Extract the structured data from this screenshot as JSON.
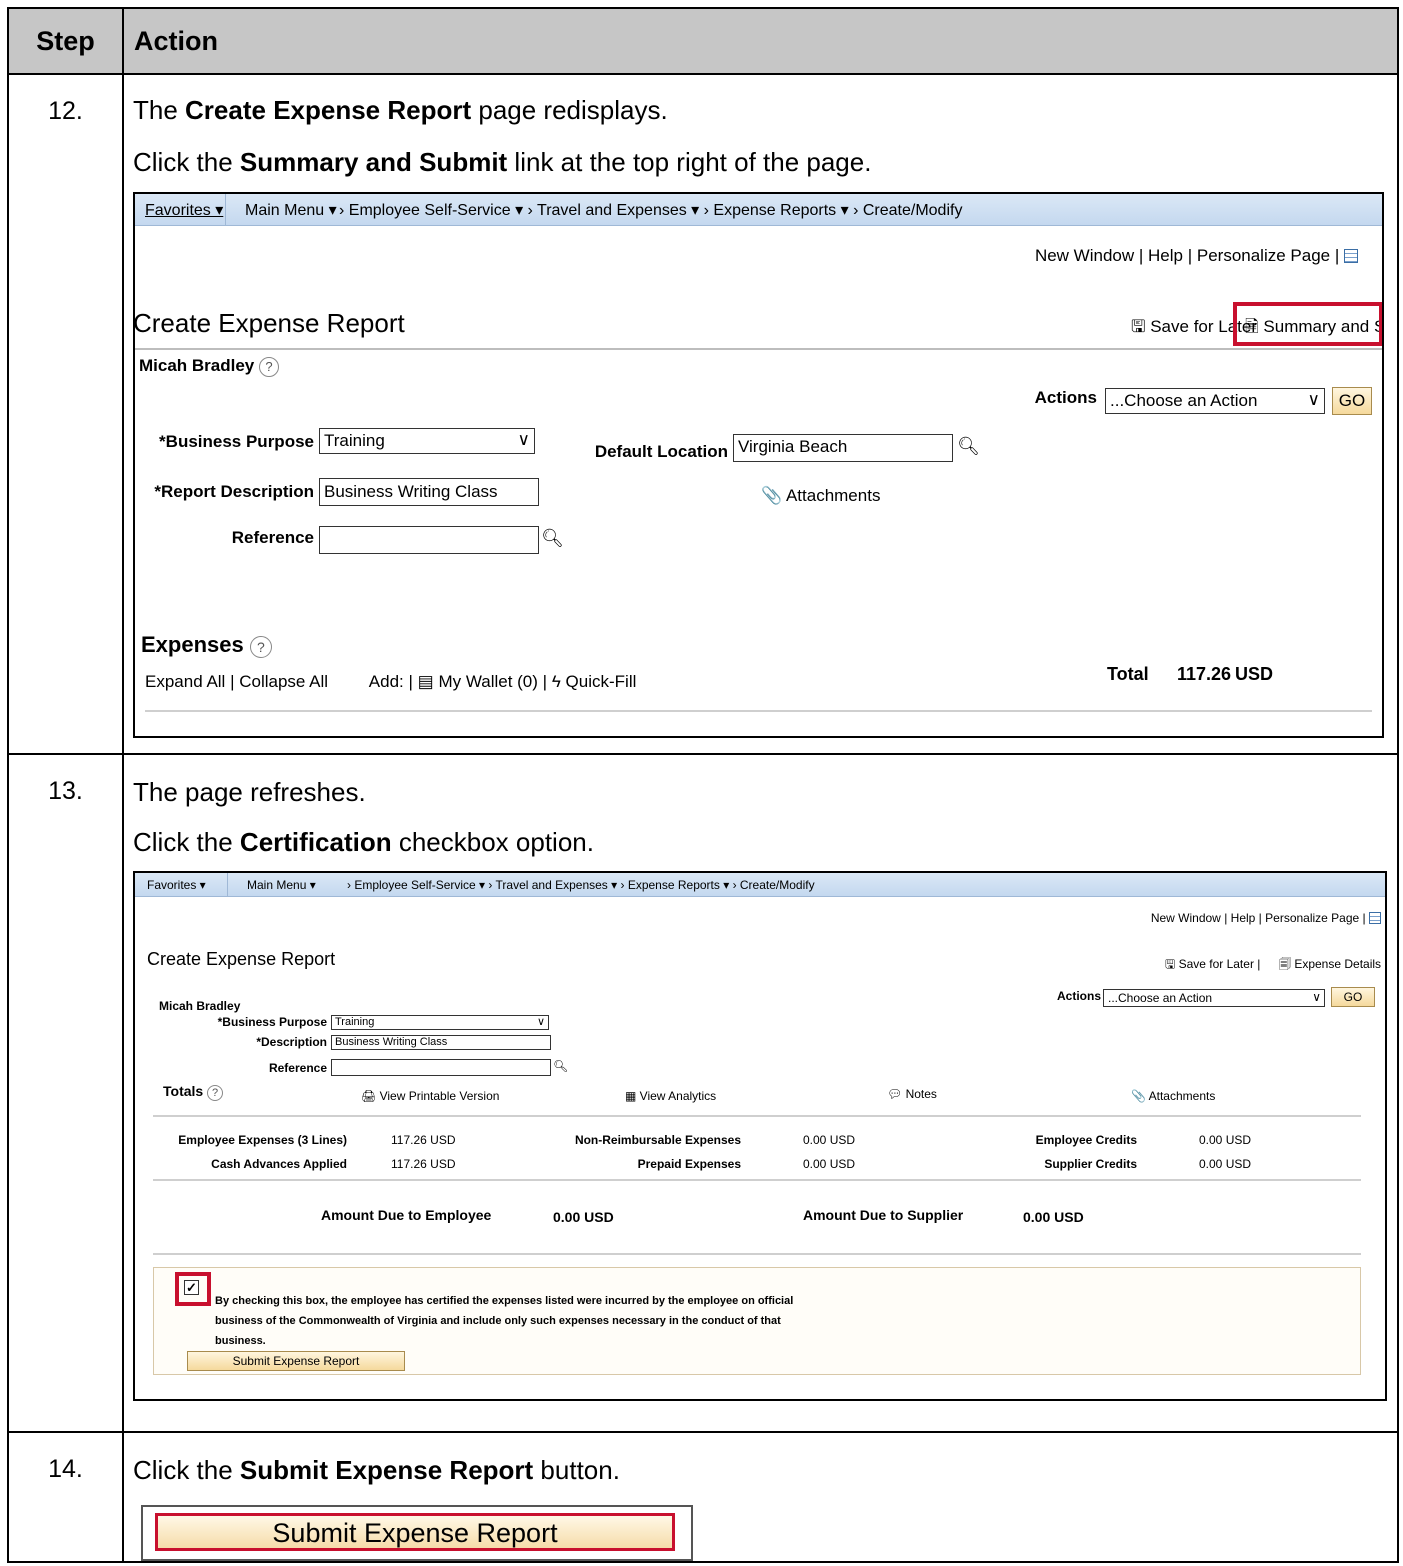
{
  "table": {
    "step_header": "Step",
    "action_header": "Action"
  },
  "step12": {
    "number": "12.",
    "line1_pre": "The ",
    "line1_bold": "Create Expense Report",
    "line1_post": " page redisplays.",
    "line2_pre": "Click the ",
    "line2_bold": "Summary and Submit",
    "line2_post": " link at the top right of the page.",
    "shot": {
      "nav": {
        "favorites": "Favorites ▾",
        "main_menu": "Main Menu ▾",
        "breadcrumb": "› Employee Self-Service ▾  ›  Travel and Expenses ▾  ›  Expense Reports ▾  ›  Create/Modify"
      },
      "top_links": {
        "new_window": "New Window",
        "help": "Help",
        "personalize": "Personalize Page"
      },
      "page_title": "Create Expense Report",
      "save_later": "Save for Later",
      "summary_submit": "Summary and Submit",
      "employee": "Micah Bradley",
      "actions_label": "Actions",
      "actions_value": "...Choose an Action",
      "go": "GO",
      "business_purpose_label": "*Business Purpose",
      "business_purpose_value": "Training",
      "report_description_label": "*Report Description",
      "report_description_value": "Business Writing Class",
      "reference_label": "Reference",
      "reference_value": "",
      "default_location_label": "Default Location",
      "default_location_value": "Virginia Beach",
      "attachments": "Attachments",
      "expenses_title": "Expenses",
      "expand_all": "Expand All",
      "collapse_all": "Collapse All",
      "add_label": "Add:",
      "my_wallet": "My Wallet (0)",
      "quick_fill": "Quick-Fill",
      "total_label": "Total",
      "total_value": "117.26",
      "total_currency": "USD"
    }
  },
  "step13": {
    "number": "13.",
    "line1": "The page refreshes.",
    "line2_pre": "Click the ",
    "line2_bold": "Certification",
    "line2_post": " checkbox option.",
    "shot": {
      "nav": {
        "favorites": "Favorites ▾",
        "main_menu": "Main Menu ▾",
        "breadcrumb": "› Employee Self-Service ▾  ›  Travel and Expenses ▾  ›  Expense Reports ▾  ›  Create/Modify"
      },
      "top_links": {
        "new_window": "New Window",
        "help": "Help",
        "personalize": "Personalize Page"
      },
      "page_title": "Create Expense Report",
      "save_later": "Save for Later",
      "expense_details": "Expense Details",
      "employee": "Micah Bradley",
      "actions_label": "Actions",
      "actions_value": "...Choose an Action",
      "go": "GO",
      "business_purpose_label": "*Business Purpose",
      "business_purpose_value": "Training",
      "description_label": "*Description",
      "description_value": "Business Writing Class",
      "reference_label": "Reference",
      "totals_title": "Totals",
      "view_printable": "View Printable Version",
      "view_analytics": "View Analytics",
      "notes": "Notes",
      "attachments": "Attachments",
      "emp_expenses_label": "Employee Expenses (3 Lines)",
      "emp_expenses_value": "117.26  USD",
      "cash_adv_label": "Cash Advances Applied",
      "cash_adv_value": "117.26  USD",
      "nonreimb_label": "Non-Reimbursable Expenses",
      "nonreimb_value": "0.00  USD",
      "prepaid_label": "Prepaid Expenses",
      "prepaid_value": "0.00  USD",
      "emp_credits_label": "Employee Credits",
      "emp_credits_value": "0.00  USD",
      "sup_credits_label": "Supplier Credits",
      "sup_credits_value": "0.00  USD",
      "due_emp_label": "Amount Due to Employee",
      "due_emp_value": "0.00  USD",
      "due_sup_label": "Amount Due to Supplier",
      "due_sup_value": "0.00  USD",
      "cert_text_1": "By checking this box, the employee has certified the expenses listed were incurred by the employee on official",
      "cert_text_2": "business of the Commonwealth of Virginia and include only such expenses necessary in the conduct of that",
      "cert_text_3": "business.",
      "submit_button": "Submit Expense Report"
    }
  },
  "step14": {
    "number": "14.",
    "line1_pre": "Click the ",
    "line1_bold": "Submit Expense Report",
    "line1_post": " button.",
    "button_label": "Submit Expense Report"
  },
  "colors": {
    "highlight": "#c8102e",
    "header_bg": "#c6c6c6",
    "nav_bg": "#c4d8ef",
    "button_bg": "#f5d99c"
  }
}
